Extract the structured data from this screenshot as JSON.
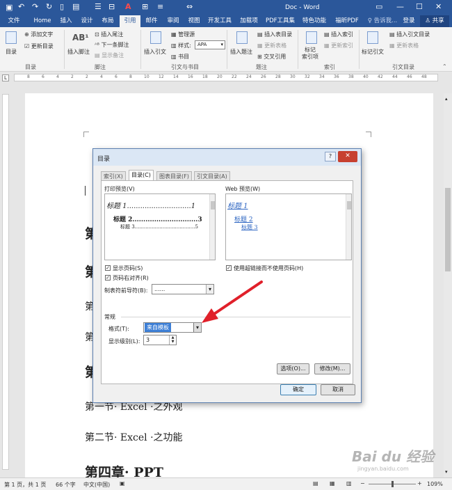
{
  "window": {
    "title": "Doc - Word",
    "sign_in": "登录",
    "share": "共享",
    "tell_me": "告诉我..."
  },
  "tabs": [
    "文件",
    "Home",
    "插入",
    "设计",
    "布局",
    "引用",
    "邮件",
    "审阅",
    "视图",
    "开发工具",
    "加载项",
    "PDF工具集",
    "特色功能",
    "福昕PDF"
  ],
  "ribbon": {
    "toc": {
      "big": "目录",
      "add_text": "添加文字",
      "update": "更新目录",
      "group": "目录"
    },
    "footnote": {
      "insert": "插入脚注",
      "insert_endnote": "插入尾注",
      "next": "下一条脚注",
      "show": "显示备注",
      "group": "脚注",
      "ab": "AB¹"
    },
    "citation": {
      "insert": "插入引文",
      "manage": "管理源",
      "style_label": "样式:",
      "style_value": "APA",
      "biblio": "书目",
      "group": "引文与书目"
    },
    "caption": {
      "insert": "插入题注",
      "insert_tof": "插入表目录",
      "update_table": "更新表格",
      "cross_ref": "交叉引用",
      "group": "题注"
    },
    "index": {
      "mark": "标记\n索引项",
      "insert": "插入索引",
      "update": "更新索引",
      "group": "索引"
    },
    "toa": {
      "mark": "标记引文",
      "insert": "插入引文目录",
      "update": "更新表格",
      "group": "引文目录"
    }
  },
  "ruler_numbers": [
    "8",
    "6",
    "4",
    "2",
    "2",
    "4",
    "6",
    "8",
    "10",
    "12",
    "14",
    "16",
    "18",
    "20",
    "22",
    "24",
    "26",
    "28",
    "30",
    "32",
    "34",
    "36",
    "38",
    "40",
    "42",
    "44",
    "46",
    "48"
  ],
  "document": {
    "lines": [
      {
        "text": "第",
        "cls": "h1"
      },
      {
        "text": "第",
        "cls": "h1"
      },
      {
        "text": "第",
        "cls": "h2"
      },
      {
        "text": "第",
        "cls": "h2"
      },
      {
        "text": "第",
        "cls": "h1"
      },
      {
        "text": "第一节· Excel ·之外观",
        "cls": "h2"
      },
      {
        "text": "第二节· Excel ·之功能",
        "cls": "h2"
      },
      {
        "text": "第四章· PPT",
        "cls": "h1"
      }
    ]
  },
  "dialog": {
    "title": "目录",
    "help": "?",
    "close": "✕",
    "tabs": [
      "索引(X)",
      "目录(C)",
      "图表目录(F)",
      "引文目录(A)"
    ],
    "print_preview_label": "打印预览(V)",
    "web_preview_label": "Web 预览(W)",
    "print_preview": [
      {
        "text": "标题 1.............................1"
      },
      {
        "text": "标题 2..............................3"
      },
      {
        "text": "标题 3.......................................5"
      }
    ],
    "web_preview": [
      "标题 1",
      "标题 2",
      "标题 3"
    ],
    "show_page_numbers": "显示页码(S)",
    "right_align": "页码右对齐(R)",
    "tab_leader_label": "制表符前导符(B):",
    "tab_leader_value": "......",
    "use_hyperlinks": "使用超链接而不使用页码(H)",
    "general": "常规",
    "formats_label": "格式(T):",
    "formats_value": "来自模板",
    "levels_label": "显示级别(L):",
    "levels_value": "3",
    "options": "选项(O)...",
    "modify": "修改(M)...",
    "ok": "确定",
    "cancel": "取消"
  },
  "status": {
    "page": "第 1 页，共 1 页",
    "words": "66 个字",
    "lang": "中文(中国)",
    "zoom": "109%"
  },
  "watermark": {
    "line1": "Bai du 经验",
    "line2": "jingyan.baidu.com"
  },
  "colors": {
    "brand": "#2b579a",
    "arrow": "#e0202a",
    "selection": "#3d7fd6"
  }
}
